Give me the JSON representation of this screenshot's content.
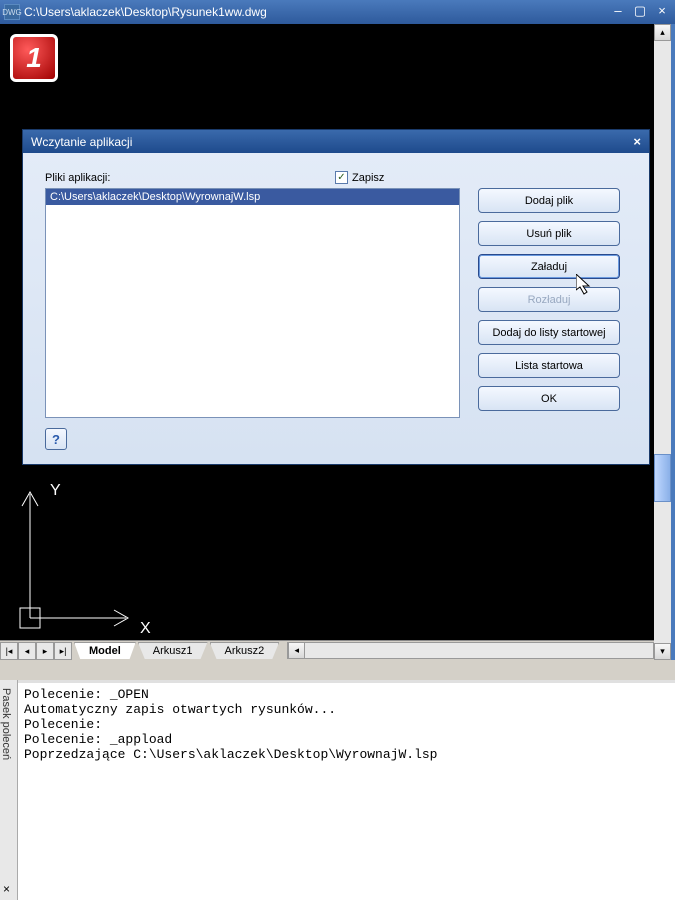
{
  "window": {
    "title": "C:\\Users\\aklaczek\\Desktop\\Rysunek1ww.dwg",
    "icon_label": "DWG"
  },
  "red_marker": "1",
  "ucs": {
    "x": "X",
    "y": "Y"
  },
  "tabs": {
    "model": "Model",
    "sheet1": "Arkusz1",
    "sheet2": "Arkusz2"
  },
  "dialog": {
    "title": "Wczytanie aplikacji",
    "files_label": "Pliki aplikacji:",
    "save_label": "Zapisz",
    "selected_item": "C:\\Users\\aklaczek\\Desktop\\WyrownajW.lsp",
    "buttons": {
      "add": "Dodaj plik",
      "remove": "Usuń plik",
      "load": "Załaduj",
      "unload": "Rozładuj",
      "add_startup": "Dodaj do listy startowej",
      "startup_list": "Lista startowa",
      "ok": "OK"
    },
    "help": "?"
  },
  "command": {
    "sidebar": "Pasek poleceń",
    "lines": "Polecenie: _OPEN\nAutomatyczny zapis otwartych rysunków...\nPolecenie:\nPolecenie: _appload\nPoprzedzające C:\\Users\\aklaczek\\Desktop\\WyrownajW.lsp"
  }
}
